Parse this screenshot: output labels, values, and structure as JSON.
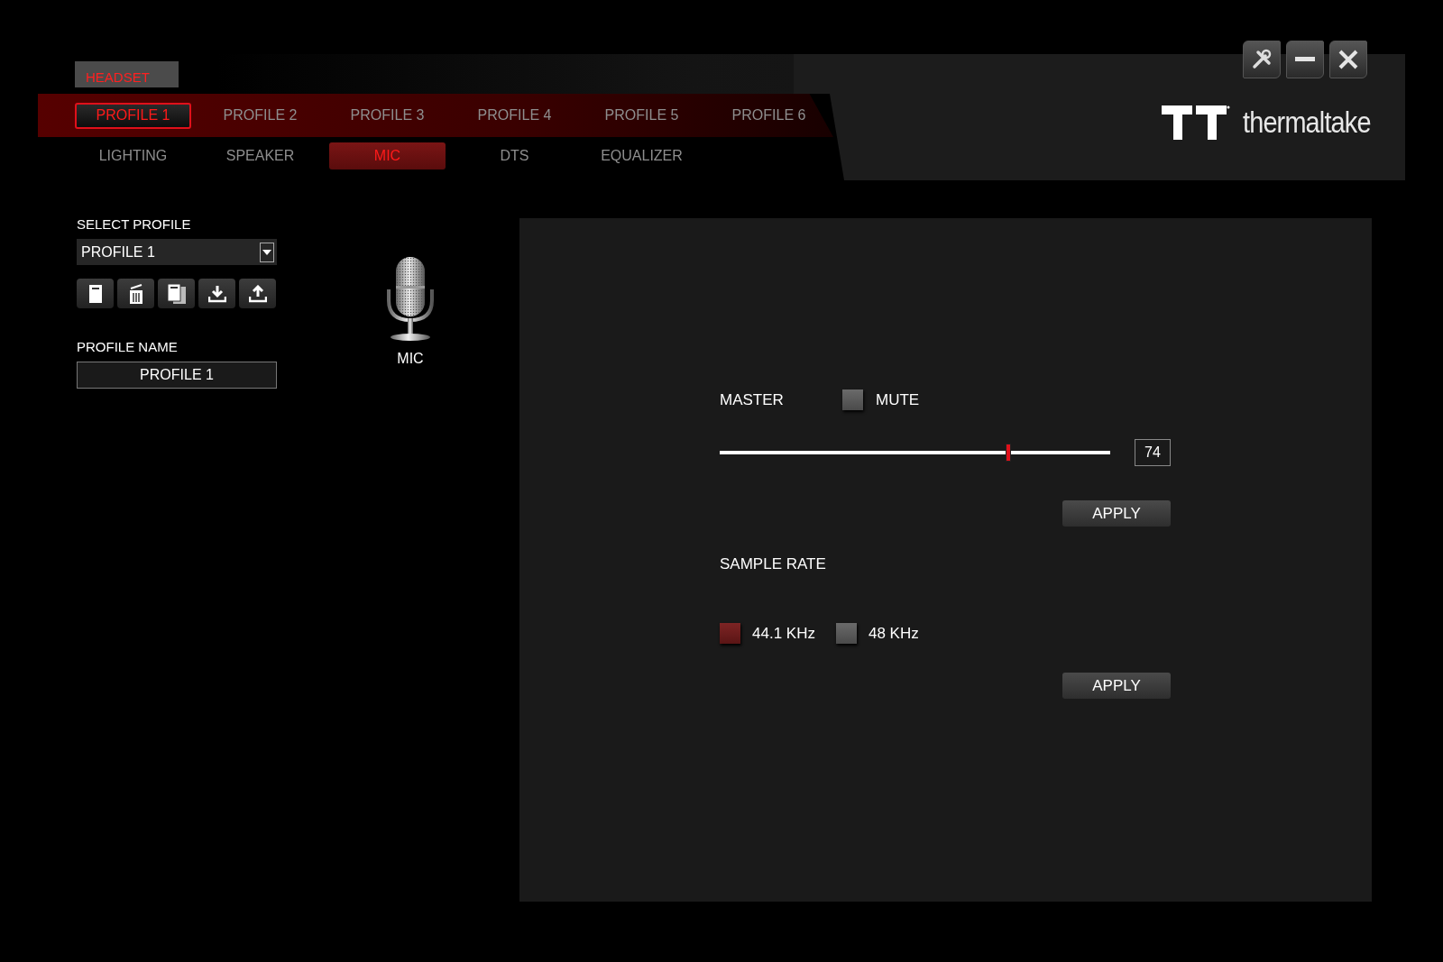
{
  "headset_tab": {
    "label": "HEADSET"
  },
  "profile_tabs": [
    {
      "label": "PROFILE 1",
      "selected": true
    },
    {
      "label": "PROFILE 2",
      "selected": false
    },
    {
      "label": "PROFILE 3",
      "selected": false
    },
    {
      "label": "PROFILE 4",
      "selected": false
    },
    {
      "label": "PROFILE 5",
      "selected": false
    },
    {
      "label": "PROFILE 6",
      "selected": false
    }
  ],
  "section_tabs": [
    {
      "label": "LIGHTING",
      "selected": false
    },
    {
      "label": "SPEAKER",
      "selected": false
    },
    {
      "label": "MIC",
      "selected": true
    },
    {
      "label": "DTS",
      "selected": false
    },
    {
      "label": "EQUALIZER",
      "selected": false
    }
  ],
  "window_buttons": [
    {
      "kind": "settings"
    },
    {
      "kind": "minimize"
    },
    {
      "kind": "close"
    }
  ],
  "logo": {
    "text": "thermaltake"
  },
  "select_profile": {
    "label": "SELECT PROFILE",
    "value": "PROFILE 1"
  },
  "profile_actions": [
    {
      "kind": "new"
    },
    {
      "kind": "delete"
    },
    {
      "kind": "copy"
    },
    {
      "kind": "import"
    },
    {
      "kind": "export"
    }
  ],
  "profile_name": {
    "label": "PROFILE NAME",
    "value": "PROFILE 1"
  },
  "device": {
    "label": "MIC"
  },
  "master": {
    "label": "MASTER",
    "mute": {
      "label": "MUTE",
      "checked": false
    },
    "level": 0.74,
    "value": "74",
    "apply": "APPLY"
  },
  "sample_rate": {
    "label": "SAMPLE RATE",
    "options": [
      {
        "label": "44.1 KHz",
        "selected": true
      },
      {
        "label": "48 KHz",
        "selected": false
      }
    ],
    "apply": "APPLY"
  }
}
